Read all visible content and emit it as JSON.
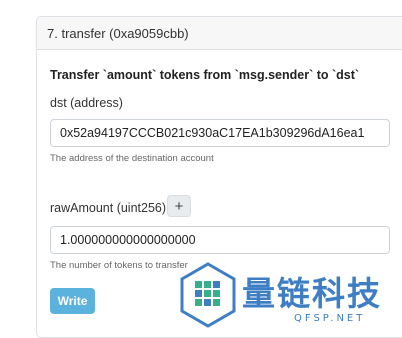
{
  "panel": {
    "header": "7. transfer (0xa9059cbb)",
    "title": "Transfer `amount` tokens from `msg.sender` to `dst`",
    "params": [
      {
        "label": "dst (address)",
        "value": "0x52a94197CCCB021c930aC17EA1b309296dA16ea1",
        "hint": "The address of the destination account"
      },
      {
        "label": "rawAmount (uint256)",
        "value": "1.000000000000000000",
        "hint": "The number of tokens to transfer",
        "add_label": "+"
      }
    ],
    "write_label": "Write"
  },
  "watermark": {
    "text": "量链科技",
    "sub": "QFSP.NET",
    "color": "#3d7ec4",
    "accent": "#37b08a"
  }
}
